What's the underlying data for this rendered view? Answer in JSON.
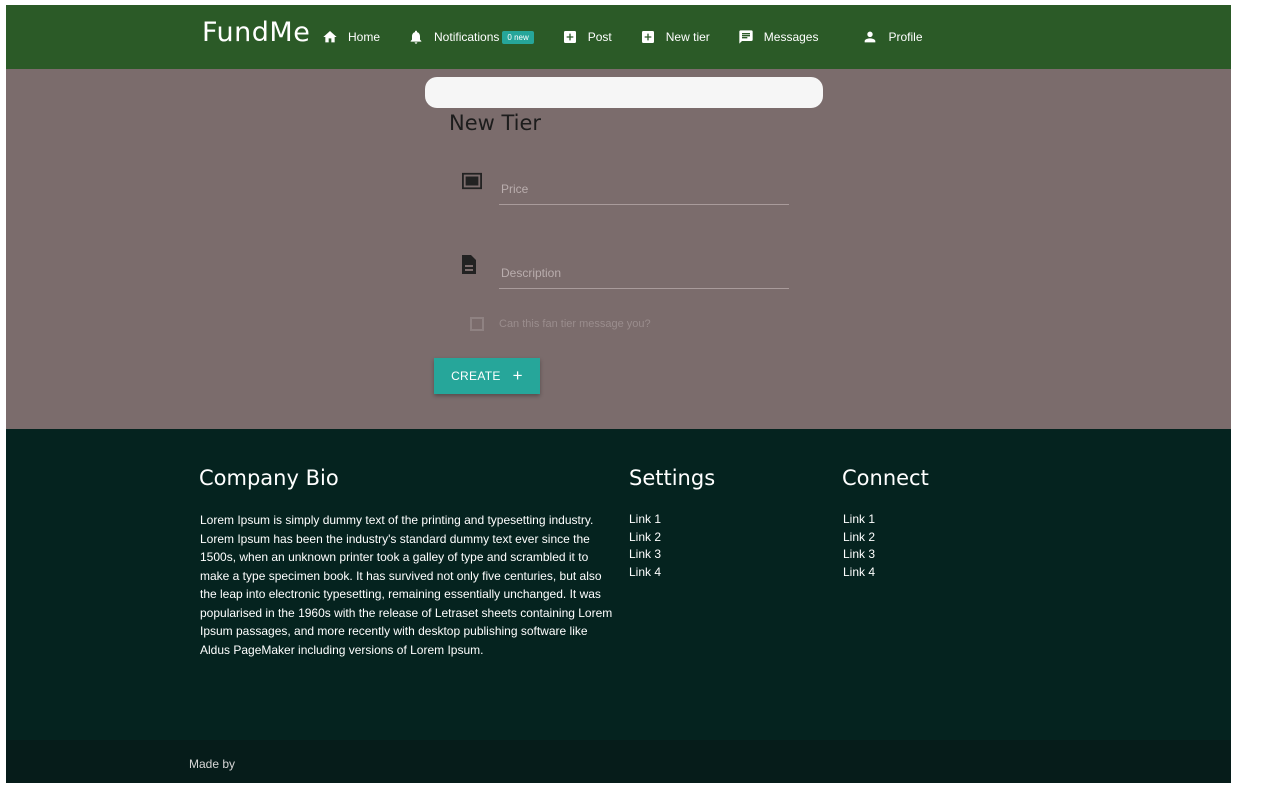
{
  "navbar": {
    "brand": "FundMe",
    "items": [
      {
        "label": "Home",
        "icon": "home-icon"
      },
      {
        "label": "Notifications",
        "icon": "bell-icon",
        "badge": "0 new"
      },
      {
        "label": "Post",
        "icon": "add-box-icon"
      },
      {
        "label": "New tier",
        "icon": "add-box-icon"
      },
      {
        "label": "Messages",
        "icon": "message-icon"
      },
      {
        "label": "Profile",
        "icon": "person-icon"
      }
    ]
  },
  "form": {
    "search_value": "",
    "title": "New Tier",
    "price_placeholder": "Price",
    "description_placeholder": "Description",
    "checkbox_label": "Can this fan tier message you?",
    "checkbox_checked": false,
    "create_label": "CREATE",
    "create_icon": "+"
  },
  "footer": {
    "bio_heading": "Company Bio",
    "bio_text": "Lorem Ipsum is simply dummy text of the printing and typesetting industry. Lorem Ipsum has been the industry's standard dummy text ever since the 1500s, when an unknown printer took a galley of type and scrambled it to make a type specimen book. It has survived not only five centuries, but also the leap into electronic typesetting, remaining essentially unchanged. It was popularised in the 1960s with the release of Letraset sheets containing Lorem Ipsum passages, and more recently with desktop publishing software like Aldus PageMaker including versions of Lorem Ipsum.",
    "settings_heading": "Settings",
    "settings_links": [
      "Link 1",
      "Link 2",
      "Link 3",
      "Link 4"
    ],
    "connect_heading": "Connect",
    "connect_links": [
      "Link 1",
      "Link 2",
      "Link 3",
      "Link 4"
    ],
    "made_by": "Made by"
  },
  "colors": {
    "navbar_bg": "#2b5a27",
    "page_bg": "#7b6c6c",
    "accent": "#26a69a",
    "footer_bg": "#05231f"
  }
}
